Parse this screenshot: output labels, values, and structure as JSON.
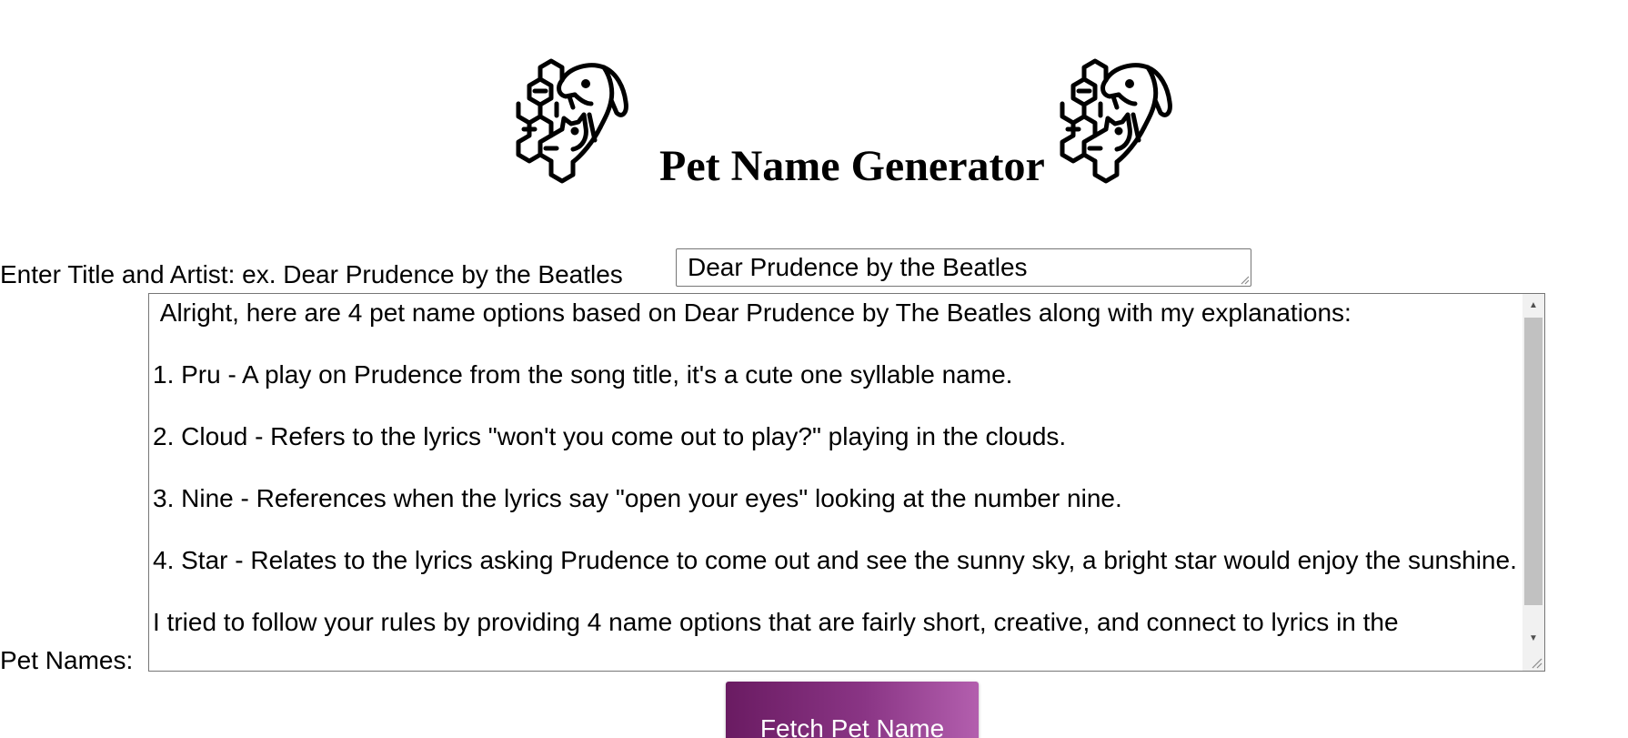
{
  "header": {
    "title": "Pet Name Generator",
    "logo_icon": "brain-pets-icon"
  },
  "song_input": {
    "label": "Enter Title and Artist: ex. Dear Prudence by the Beatles",
    "value": "Dear Prudence by the Beatles"
  },
  "pet_names": {
    "label": "Pet Names:",
    "text": " Alright, here are 4 pet name options based on Dear Prudence by The Beatles along with my explanations:\n\n1. Pru - A play on Prudence from the song title, it's a cute one syllable name.\n\n2. Cloud - Refers to the lyrics \"won't you come out to play?\" playing in the clouds.\n\n3. Nine - References when the lyrics say \"open your eyes\" looking at the number nine.\n\n4. Star - Relates to the lyrics asking Prudence to come out and see the sunny sky, a bright star would enjoy the sunshine.\n\nI tried to follow your rules by providing 4 name options that are fairly short, creative, and connect to lyrics in the"
  },
  "fetch_button": {
    "label": "Fetch Pet Name",
    "gradient_start": "#6a1b62",
    "gradient_end": "#b35fae"
  }
}
